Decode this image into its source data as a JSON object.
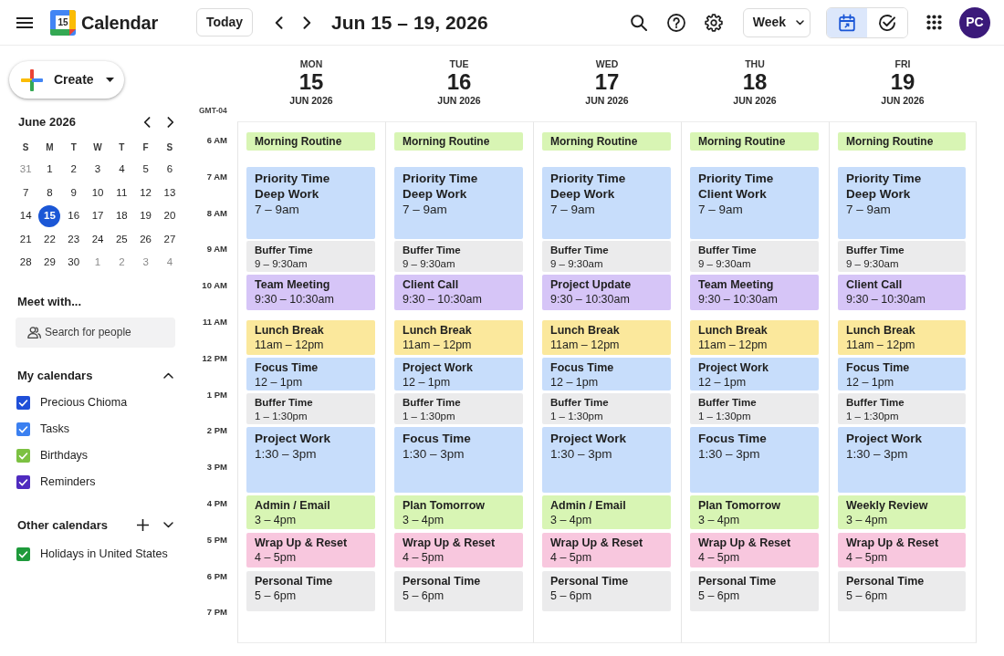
{
  "topbar": {
    "logo_day": "15",
    "app_name": "Calendar",
    "today_button": "Today",
    "date_range": "Jun 15 – 19, 2026",
    "view_select": "Week",
    "view_toggle": [
      {
        "kind": "calendar",
        "selected": true
      },
      {
        "kind": "tasks",
        "selected": false
      }
    ],
    "avatar": "PC"
  },
  "sidebar": {
    "create_button": "Create",
    "mini_calendar": {
      "month": "June 2026",
      "weekdays": [
        "S",
        "M",
        "T",
        "W",
        "T",
        "F",
        "S"
      ],
      "days": [
        {
          "label": "31",
          "muted": true,
          "selected": false
        },
        {
          "label": "1",
          "muted": false,
          "selected": false
        },
        {
          "label": "2",
          "muted": false,
          "selected": false
        },
        {
          "label": "3",
          "muted": false,
          "selected": false
        },
        {
          "label": "4",
          "muted": false,
          "selected": false
        },
        {
          "label": "5",
          "muted": false,
          "selected": false
        },
        {
          "label": "6",
          "muted": false,
          "selected": false
        },
        {
          "label": "7",
          "muted": false,
          "selected": false
        },
        {
          "label": "8",
          "muted": false,
          "selected": false
        },
        {
          "label": "9",
          "muted": false,
          "selected": false
        },
        {
          "label": "10",
          "muted": false,
          "selected": false
        },
        {
          "label": "11",
          "muted": false,
          "selected": false
        },
        {
          "label": "12",
          "muted": false,
          "selected": false
        },
        {
          "label": "13",
          "muted": false,
          "selected": false
        },
        {
          "label": "14",
          "muted": false,
          "selected": false
        },
        {
          "label": "15",
          "muted": false,
          "selected": true
        },
        {
          "label": "16",
          "muted": false,
          "selected": false
        },
        {
          "label": "17",
          "muted": false,
          "selected": false
        },
        {
          "label": "18",
          "muted": false,
          "selected": false
        },
        {
          "label": "19",
          "muted": false,
          "selected": false
        },
        {
          "label": "20",
          "muted": false,
          "selected": false
        },
        {
          "label": "21",
          "muted": false,
          "selected": false
        },
        {
          "label": "22",
          "muted": false,
          "selected": false
        },
        {
          "label": "23",
          "muted": false,
          "selected": false
        },
        {
          "label": "24",
          "muted": false,
          "selected": false
        },
        {
          "label": "25",
          "muted": false,
          "selected": false
        },
        {
          "label": "26",
          "muted": false,
          "selected": false
        },
        {
          "label": "27",
          "muted": false,
          "selected": false
        },
        {
          "label": "28",
          "muted": false,
          "selected": false
        },
        {
          "label": "29",
          "muted": false,
          "selected": false
        },
        {
          "label": "30",
          "muted": false,
          "selected": false
        },
        {
          "label": "1",
          "muted": true,
          "selected": false
        },
        {
          "label": "2",
          "muted": true,
          "selected": false
        },
        {
          "label": "3",
          "muted": true,
          "selected": false
        },
        {
          "label": "4",
          "muted": true,
          "selected": false
        }
      ]
    },
    "meet_with": {
      "heading": "Meet with...",
      "placeholder": "Search for people"
    },
    "my_calendars": {
      "heading": "My calendars",
      "expanded": true,
      "items": [
        {
          "label": "Precious Chioma",
          "checked": true,
          "color": "#1f4fd8"
        },
        {
          "label": "Tasks",
          "checked": true,
          "color": "#3b80f0"
        },
        {
          "label": "Birthdays",
          "checked": true,
          "color": "#7cc142"
        },
        {
          "label": "Reminders",
          "checked": true,
          "color": "#4f2bbf"
        }
      ]
    },
    "other_calendars": {
      "heading": "Other calendars",
      "addable": true,
      "expanded": false,
      "items": [
        {
          "label": "Holidays in United States",
          "checked": true,
          "color": "#1e9a3b"
        }
      ]
    }
  },
  "week": {
    "timezone": "GMT-04",
    "hours": [
      "6 AM",
      "7 AM",
      "8 AM",
      "9 AM",
      "10 AM",
      "11 AM",
      "12 PM",
      "1 PM",
      "2 PM",
      "3 PM",
      "4 PM",
      "5 PM",
      "6 PM",
      "7 PM"
    ],
    "days": [
      {
        "weekday": "MON",
        "day": "15",
        "month": "JUN 2026",
        "events": [
          {
            "title": "Morning Routine",
            "color": "#d8f5b4"
          },
          {
            "title": "Priority Time",
            "subtitle": "Deep Work",
            "time": "7 – 9am",
            "color": "#c7ddfb"
          },
          {
            "title": "Buffer Time",
            "time": "9 – 9:30am",
            "color": "#ebebec"
          },
          {
            "title": "Team Meeting",
            "time": "9:30 – 10:30am",
            "color": "#d6c5f7"
          },
          {
            "title": "Lunch Break",
            "time": "11am – 12pm",
            "color": "#fbe89c"
          },
          {
            "title": "Focus Time",
            "time": "12 – 1pm",
            "color": "#c7ddfb"
          },
          {
            "title": "Buffer Time",
            "time": "1 – 1:30pm",
            "color": "#ebebec"
          },
          {
            "title": "Project Work",
            "time": "1:30 – 3pm",
            "color": "#c7ddfb"
          },
          {
            "title": "Admin / Email",
            "time": "3 – 4pm",
            "color": "#d8f5b4"
          },
          {
            "title": "Wrap Up & Reset",
            "time": "4 – 5pm",
            "color": "#f8c7de"
          },
          {
            "title": "Personal Time",
            "time": "5 – 6pm",
            "color": "#ebebec"
          }
        ]
      },
      {
        "weekday": "TUE",
        "day": "16",
        "month": "JUN 2026",
        "events": [
          {
            "title": "Morning Routine",
            "color": "#d8f5b4"
          },
          {
            "title": "Priority Time",
            "subtitle": "Deep Work",
            "time": "7 – 9am",
            "color": "#c7ddfb"
          },
          {
            "title": "Buffer Time",
            "time": "9 – 9:30am",
            "color": "#ebebec"
          },
          {
            "title": "Client Call",
            "time": "9:30 – 10:30am",
            "color": "#d6c5f7"
          },
          {
            "title": "Lunch Break",
            "time": "11am – 12pm",
            "color": "#fbe89c"
          },
          {
            "title": "Project Work",
            "time": "12 – 1pm",
            "color": "#c7ddfb"
          },
          {
            "title": "Buffer Time",
            "time": "1 – 1:30pm",
            "color": "#ebebec"
          },
          {
            "title": "Focus Time",
            "time": "1:30 – 3pm",
            "color": "#c7ddfb"
          },
          {
            "title": "Plan Tomorrow",
            "time": "3 – 4pm",
            "color": "#d8f5b4"
          },
          {
            "title": "Wrap Up & Reset",
            "time": "4 – 5pm",
            "color": "#f8c7de"
          },
          {
            "title": "Personal Time",
            "time": "5 – 6pm",
            "color": "#ebebec"
          }
        ]
      },
      {
        "weekday": "WED",
        "day": "17",
        "month": "JUN 2026",
        "events": [
          {
            "title": "Morning Routine",
            "color": "#d8f5b4"
          },
          {
            "title": "Priority Time",
            "subtitle": "Deep Work",
            "time": "7 – 9am",
            "color": "#c7ddfb"
          },
          {
            "title": "Buffer Time",
            "time": "9 – 9:30am",
            "color": "#ebebec"
          },
          {
            "title": "Project Update",
            "time": "9:30 – 10:30am",
            "color": "#d6c5f7"
          },
          {
            "title": "Lunch Break",
            "time": "11am – 12pm",
            "color": "#fbe89c"
          },
          {
            "title": "Focus Time",
            "time": "12 – 1pm",
            "color": "#c7ddfb"
          },
          {
            "title": "Buffer Time",
            "time": "1 – 1:30pm",
            "color": "#ebebec"
          },
          {
            "title": "Project Work",
            "time": "1:30 – 3pm",
            "color": "#c7ddfb"
          },
          {
            "title": "Admin / Email",
            "time": "3 – 4pm",
            "color": "#d8f5b4"
          },
          {
            "title": "Wrap Up & Reset",
            "time": "4 – 5pm",
            "color": "#f8c7de"
          },
          {
            "title": "Personal Time",
            "time": "5 – 6pm",
            "color": "#ebebec"
          }
        ]
      },
      {
        "weekday": "THU",
        "day": "18",
        "month": "JUN 2026",
        "events": [
          {
            "title": "Morning Routine",
            "color": "#d8f5b4"
          },
          {
            "title": "Priority Time",
            "subtitle": "Client Work",
            "time": "7 – 9am",
            "color": "#c7ddfb"
          },
          {
            "title": "Buffer Time",
            "time": "9 – 9:30am",
            "color": "#ebebec"
          },
          {
            "title": "Team Meeting",
            "time": "9:30 – 10:30am",
            "color": "#d6c5f7"
          },
          {
            "title": "Lunch Break",
            "time": "11am – 12pm",
            "color": "#fbe89c"
          },
          {
            "title": "Project Work",
            "time": "12 – 1pm",
            "color": "#c7ddfb"
          },
          {
            "title": "Buffer Time",
            "time": "1 – 1:30pm",
            "color": "#ebebec"
          },
          {
            "title": "Focus Time",
            "time": "1:30 – 3pm",
            "color": "#c7ddfb"
          },
          {
            "title": "Plan Tomorrow",
            "time": "3 – 4pm",
            "color": "#d8f5b4"
          },
          {
            "title": "Wrap Up & Reset",
            "time": "4 – 5pm",
            "color": "#f8c7de"
          },
          {
            "title": "Personal Time",
            "time": "5 – 6pm",
            "color": "#ebebec"
          }
        ]
      },
      {
        "weekday": "FRI",
        "day": "19",
        "month": "JUN 2026",
        "events": [
          {
            "title": "Morning Routine",
            "color": "#d8f5b4"
          },
          {
            "title": "Priority Time",
            "subtitle": "Deep Work",
            "time": "7 – 9am",
            "color": "#c7ddfb"
          },
          {
            "title": "Buffer Time",
            "time": "9 – 9:30am",
            "color": "#ebebec"
          },
          {
            "title": "Client Call",
            "time": "9:30 – 10:30am",
            "color": "#d6c5f7"
          },
          {
            "title": "Lunch Break",
            "time": "11am – 12pm",
            "color": "#fbe89c"
          },
          {
            "title": "Focus Time",
            "time": "12 – 1pm",
            "color": "#c7ddfb"
          },
          {
            "title": "Buffer Time",
            "time": "1 – 1:30pm",
            "color": "#ebebec"
          },
          {
            "title": "Project Work",
            "time": "1:30 – 3pm",
            "color": "#c7ddfb"
          },
          {
            "title": "Weekly Review",
            "time": "3 – 4pm",
            "color": "#d8f5b4"
          },
          {
            "title": "Wrap Up & Reset",
            "time": "4 – 5pm",
            "color": "#f8c7de"
          },
          {
            "title": "Personal Time",
            "time": "5 – 6pm",
            "color": "#ebebec"
          }
        ]
      }
    ]
  }
}
